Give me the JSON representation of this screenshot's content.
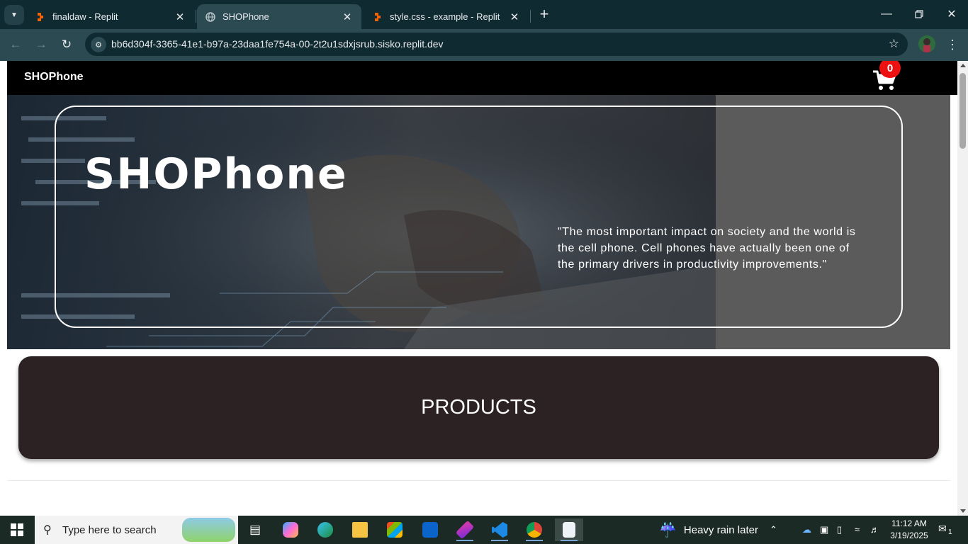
{
  "browser": {
    "tabs": [
      {
        "title": "finaldaw - Replit",
        "active": false,
        "favicon": "replit-icon"
      },
      {
        "title": "SHOPhone",
        "active": true,
        "favicon": "globe-icon"
      },
      {
        "title": "style.css - example - Replit",
        "active": false,
        "favicon": "replit-icon"
      }
    ],
    "url": "bb6d304f-3365-41e1-b97a-23daa1fe754a-00-2t2u1sdxjsrub.sisko.replit.dev"
  },
  "page": {
    "brand": "SHOPhone",
    "cart_count": "0",
    "hero": {
      "title": "SHOPhone",
      "quote": "\"The most important impact on society and the world is the cell phone. Cell phones have actually been one of the primary drivers in productivity improvements.\""
    },
    "products_title": "PRODUCTS"
  },
  "taskbar": {
    "search_placeholder": "Type here to search",
    "weather": "Heavy rain later",
    "time": "11:12 AM",
    "date": "3/19/2025",
    "notification_count": "1"
  },
  "colors": {
    "browser_frame": "#0f2a30",
    "toolbar": "#2b4a52",
    "nav_bg": "#000000",
    "cart_badge": "#ee1111",
    "products_bg": "#2c2224"
  }
}
